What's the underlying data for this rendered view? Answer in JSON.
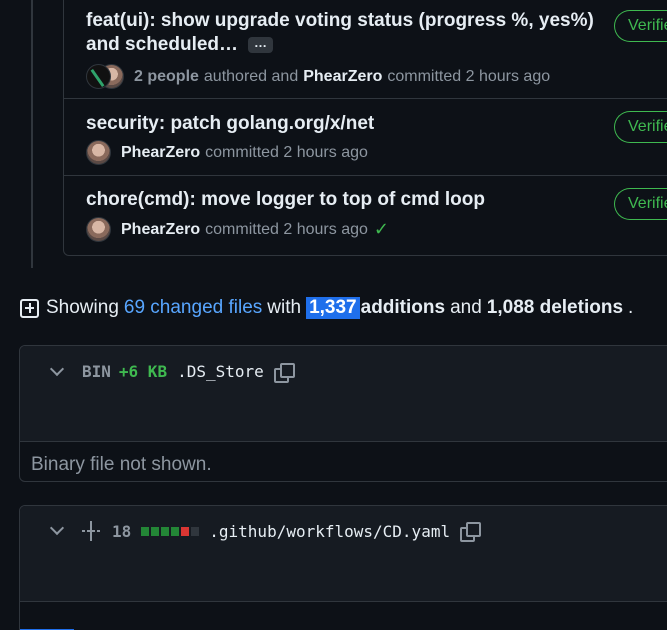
{
  "commits": [
    {
      "title_line_1": "feat(ui): show upgrade voting status (progress %, yes%)",
      "title_line_2": "and scheduled…",
      "ellipsis": "…",
      "people": "2 people",
      "authored_text": "authored and",
      "committer": "PhearZero",
      "committed_text": "committed 2 hours ago",
      "verified": "Verified"
    },
    {
      "title": "security: patch golang.org/x/net",
      "committer": "PhearZero",
      "committed_text": "committed 2 hours ago",
      "verified": "Verified"
    },
    {
      "title": "chore(cmd): move logger to top of cmd loop",
      "committer": "PhearZero",
      "committed_text": "committed 2 hours ago",
      "check": "✓",
      "verified": "Verified"
    }
  ],
  "summary": {
    "showing": "Showing",
    "changed_files": "69 changed files",
    "with": "with",
    "additions_count": "1,337",
    "additions": "additions",
    "and": "and",
    "deletions": "1,088 deletions",
    "period": "."
  },
  "files": [
    {
      "bin": "BIN",
      "size_change": "+6 KB",
      "filename": ".DS_Store",
      "note": "Binary file not shown."
    },
    {
      "changes": "18",
      "filename": ".github/workflows/CD.yaml",
      "diffstat": [
        "#238636",
        "#238636",
        "#238636",
        "#238636",
        "#da3633",
        "#30363d"
      ]
    }
  ],
  "colors": {
    "background": "#0d1117",
    "panel": "#161b22",
    "border": "#30363d",
    "link": "#58a6ff",
    "addition": "#3fb950",
    "deletion": "#da3633",
    "selection": "#1f6feb"
  },
  "icons": {
    "summary": "file-diff-icon",
    "copy": "copy-icon",
    "expand": "unfold-icon",
    "chevron": "chevron-down-icon",
    "check": "check-icon"
  }
}
